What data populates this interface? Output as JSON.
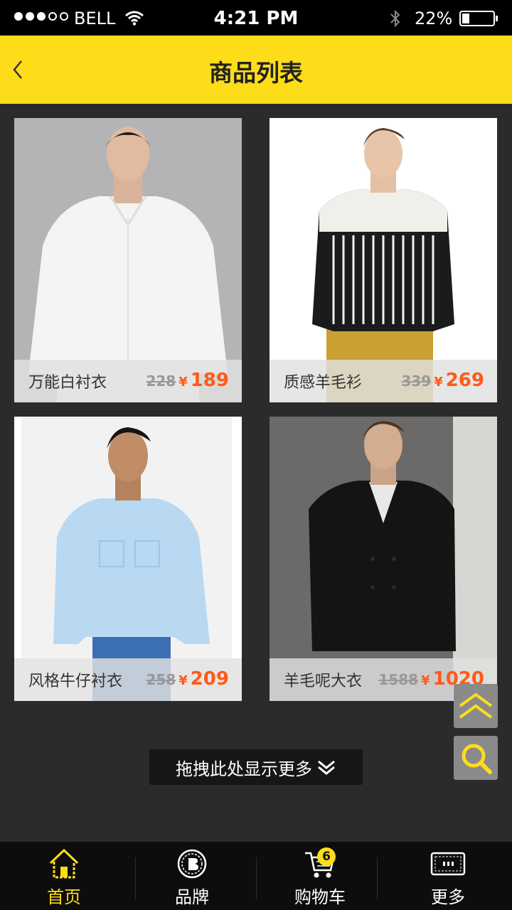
{
  "status_bar": {
    "carrier": "BELL",
    "time": "4:21 PM",
    "battery_percent": "22%",
    "signal_bars": 3,
    "signal_total": 5
  },
  "header": {
    "title": "商品列表",
    "back_icon": "chevron-left-icon"
  },
  "colors": {
    "accent": "#fddd1a",
    "price": "#ff5a1a",
    "background": "#2b2b2d"
  },
  "products": [
    {
      "name": "万能白衬衣",
      "old_price": "228",
      "currency": "¥",
      "price": "189"
    },
    {
      "name": "质感羊毛衫",
      "old_price": "339",
      "currency": "¥",
      "price": "269"
    },
    {
      "name": "风格牛仔衬衣",
      "old_price": "258",
      "currency": "¥",
      "price": "209"
    },
    {
      "name": "羊毛呢大衣",
      "old_price": "1588",
      "currency": "¥",
      "price": "1020"
    }
  ],
  "load_more": {
    "label": "拖拽此处显示更多"
  },
  "floating": {
    "top_icon": "double-chevron-up-icon",
    "search_icon": "search-icon"
  },
  "tabbar": {
    "tabs": [
      {
        "label": "首页",
        "icon": "home-icon",
        "active": true
      },
      {
        "label": "品牌",
        "icon": "brand-icon",
        "active": false
      },
      {
        "label": "购物车",
        "icon": "cart-icon",
        "active": false
      },
      {
        "label": "更多",
        "icon": "more-icon",
        "active": false
      }
    ],
    "cart_badge": "6"
  }
}
